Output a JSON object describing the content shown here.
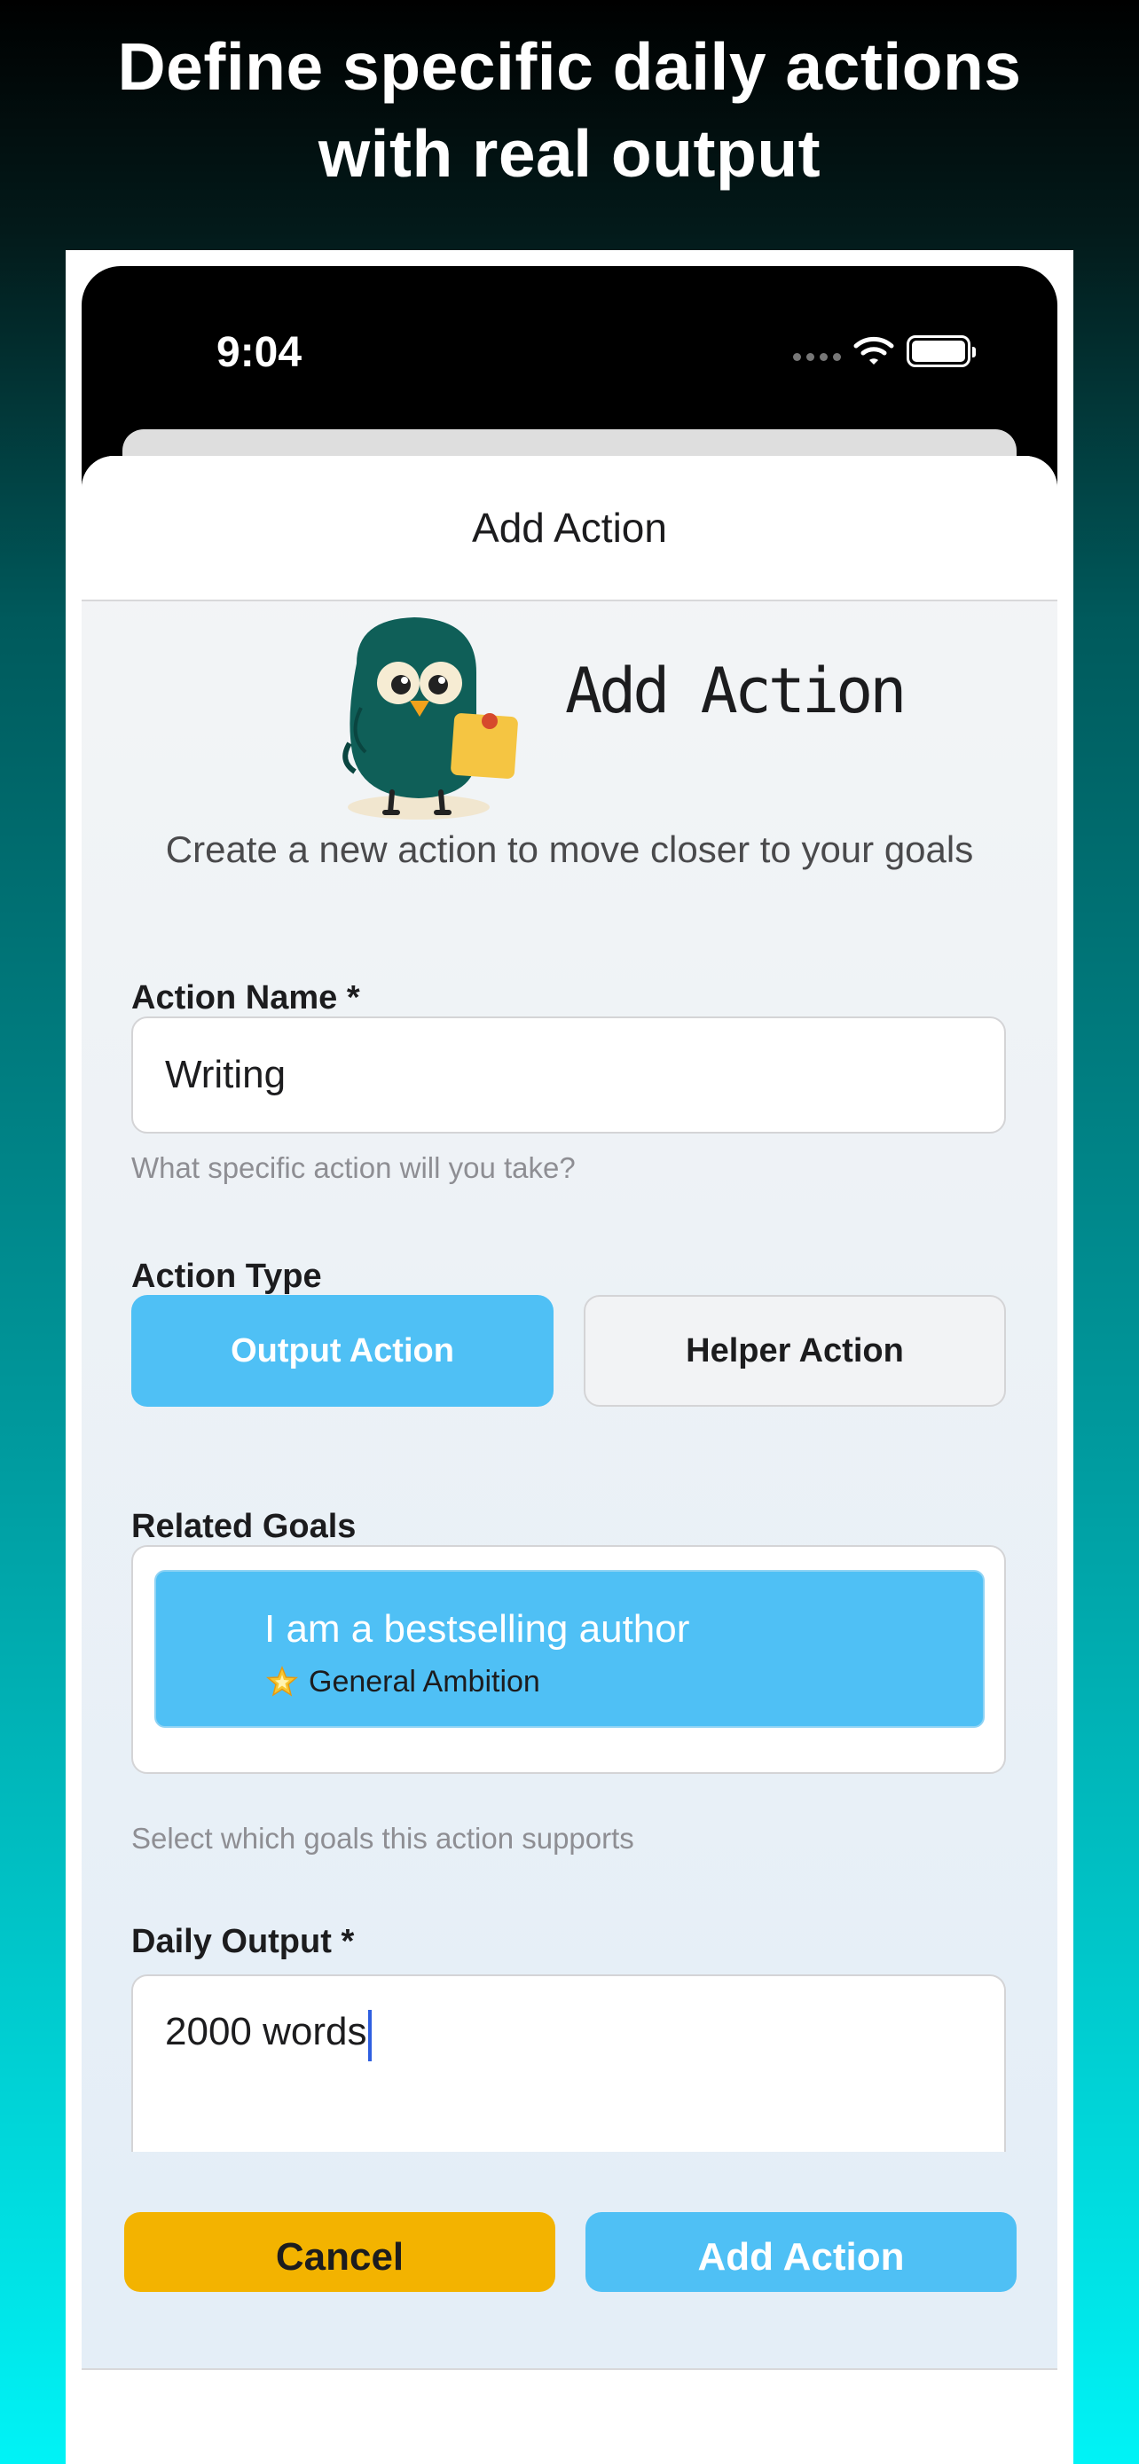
{
  "headline": {
    "line1": "Define specific daily actions",
    "line2": "with real output"
  },
  "status_bar": {
    "time": "9:04",
    "icons": [
      "signal-dots-icon",
      "wifi-icon",
      "battery-icon"
    ]
  },
  "sheet": {
    "title": "Add Action"
  },
  "hero": {
    "title": "Add Action",
    "mascot": "owl-with-note-icon",
    "subtitle": "Create a new action to move closer to your goals"
  },
  "form": {
    "action_name": {
      "label": "Action Name *",
      "value": "Writing",
      "hint": "What specific action will you take?"
    },
    "action_type": {
      "label": "Action Type",
      "options": [
        "Output Action",
        "Helper Action"
      ],
      "selected": "Output Action"
    },
    "related_goals": {
      "label": "Related Goals",
      "goals": [
        {
          "title": "I am a bestselling author",
          "category": "General Ambition",
          "category_icon": "glowing-star-icon",
          "selected": true
        }
      ],
      "hint": "Select which goals this action supports"
    },
    "daily_output": {
      "label": "Daily Output *",
      "value": "2000 words"
    }
  },
  "footer": {
    "cancel_label": "Cancel",
    "add_label": "Add Action"
  },
  "colors": {
    "accent_blue": "#4fc0f5",
    "cancel_yellow": "#f3b300",
    "owl_teal": "#0f5f58",
    "background_top": "#000000",
    "background_bottom": "#00f3f6"
  }
}
